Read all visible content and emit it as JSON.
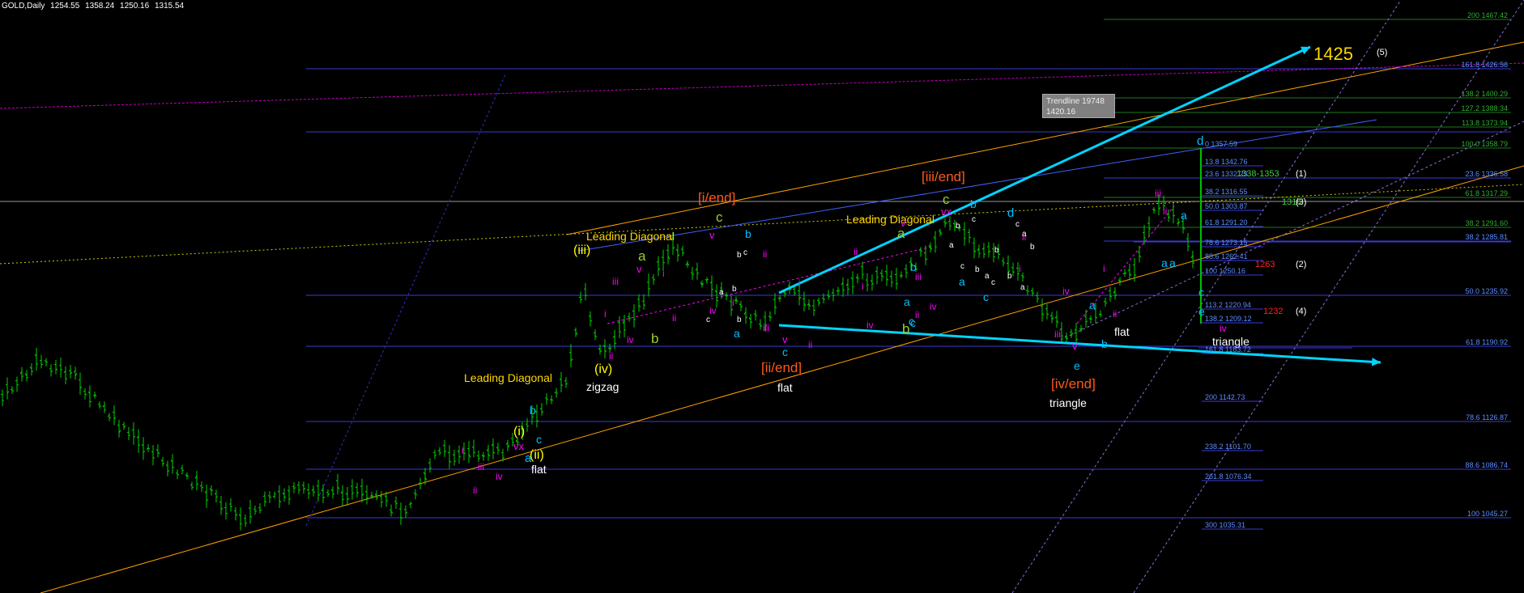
{
  "header": {
    "symbol": "GOLD,Daily",
    "open": "1254.55",
    "high": "1358.24",
    "low": "1250.16",
    "close": "1315.54"
  },
  "trendline_box": {
    "line1": "Trendline 19748",
    "line2": "1420.16"
  },
  "colors": {
    "bull": "#00d000",
    "background": "#000000",
    "fib_blue": "#3a3ad8",
    "fib_green": "#1c7a1c",
    "target_yellow": "#ffff00",
    "cyan": "#00d4ff",
    "orange": "#ffa000",
    "magenta": "#ff00ff",
    "red_orange": "#ff5a1a"
  },
  "chart_data": {
    "type": "candlestick",
    "symbol": "GOLD",
    "timeframe": "Daily",
    "ohlc": {
      "open": 1254.55,
      "high": 1358.24,
      "low": 1250.16,
      "close": 1315.54
    },
    "target": "1425",
    "fib_levels_left": [
      {
        "label": "200",
        "value": "1467.42"
      },
      {
        "label": "161.8",
        "value": "1426.56"
      },
      {
        "label": "138.2",
        "value": "1400.29"
      },
      {
        "label": "127.2",
        "value": "1388.34"
      },
      {
        "label": "113.8",
        "value": "1373.94"
      },
      {
        "label": "100.0",
        "value": "1358.79"
      },
      {
        "label": "23.6",
        "value": "1336.58"
      },
      {
        "label": "61.8",
        "value": "1317.29"
      },
      {
        "label": "38.2",
        "value": "1291.60"
      },
      {
        "label": "38.2",
        "value": "1285.81"
      },
      {
        "label": "50.0",
        "value": "1235.92"
      },
      {
        "label": "61.8",
        "value": "1190.92"
      },
      {
        "label": "78.6",
        "value": "1126.87"
      },
      {
        "label": "88.6",
        "value": "1086.74"
      },
      {
        "label": "100",
        "value": "1045.27"
      }
    ],
    "fib_levels_right": [
      {
        "label": "0",
        "value": "1357.59"
      },
      {
        "label": "13.8",
        "value": "1342.76"
      },
      {
        "label": "23.6",
        "value": "1332.23"
      },
      {
        "label": "38.2",
        "value": "1316.55"
      },
      {
        "label": "50.0",
        "value": "1303.87"
      },
      {
        "label": "61.8",
        "value": "1291.20"
      },
      {
        "label": "78.6",
        "value": "1273.15"
      },
      {
        "label": "88.6",
        "value": "1262.41"
      },
      {
        "label": "100",
        "value": "1250.16"
      },
      {
        "label": "113.2",
        "value": "1220.94"
      },
      {
        "label": "138.2",
        "value": "1209.12"
      },
      {
        "label": "161.8",
        "value": "1183.72"
      },
      {
        "label": "200",
        "value": "1142.73"
      },
      {
        "label": "238.2",
        "value": "1101.70"
      },
      {
        "label": "261.8",
        "value": "1076.34"
      },
      {
        "label": "300",
        "value": "1035.31"
      }
    ],
    "targets": [
      {
        "text": "1338-1353",
        "wave": "(1)"
      },
      {
        "text": "1316",
        "wave": "(3)"
      },
      {
        "text": "1263",
        "wave": "(2)"
      },
      {
        "text": "1232",
        "wave": "(4)"
      },
      {
        "text": "1425",
        "wave": "(5)"
      }
    ],
    "wave_labels": [
      "Leading Diagonal",
      "Leading Diagonal",
      "Leading Diagonal",
      "[i/end]",
      "[ii/end]",
      "[iii/end]",
      "[iv/end]",
      "zigzag",
      "flat",
      "flat",
      "flat",
      "triangle",
      "triangle",
      "(i)",
      "(ii)",
      "(iii)",
      "(iv)"
    ]
  }
}
